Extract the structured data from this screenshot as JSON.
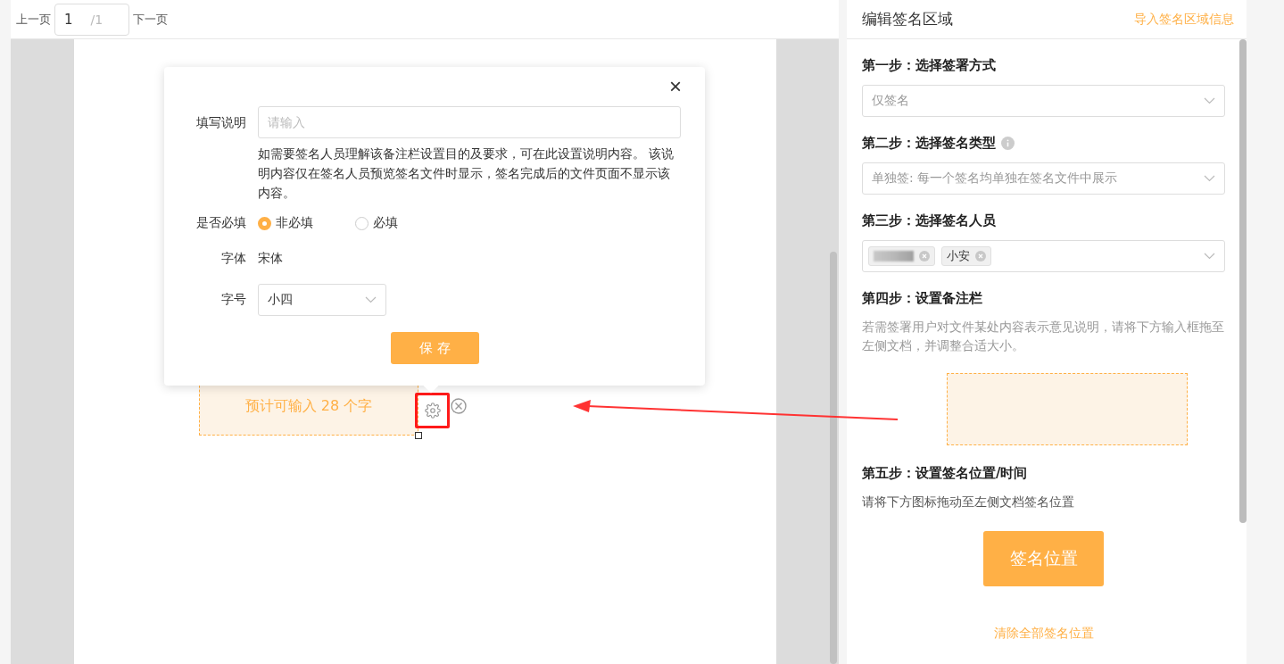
{
  "pager": {
    "prev": "上一页",
    "page": "1",
    "total": "/1",
    "next": "下一页"
  },
  "popover": {
    "close": "×",
    "fields": [
      {
        "kind": "input",
        "label": "填写说明",
        "placeholder": "请输入",
        "help": "如需要签名人员理解该备注栏设置目的及要求，可在此设置说明内容。 该说明内容仅在签名人员预览签名文件时显示，签名完成后的文件页面不显示该内容。"
      },
      {
        "kind": "radio",
        "label": "是否必填",
        "options": [
          {
            "label": "非必填",
            "selected": true
          },
          {
            "label": "必填",
            "selected": false
          }
        ]
      },
      {
        "kind": "text",
        "label": "字体",
        "value": "宋体"
      },
      {
        "kind": "select",
        "label": "字号",
        "value": "小四"
      }
    ],
    "save": "保 存"
  },
  "annotation": {
    "text": "预计可输入 28 个字",
    "highlighted": true
  },
  "panel": {
    "title": "编辑签名区域",
    "import_link": "导入签名区域信息",
    "steps": [
      {
        "kind": "select",
        "title": "第一步：选择签署方式",
        "value": "仅签名"
      },
      {
        "kind": "select",
        "title": "第二步：选择签名类型",
        "info": true,
        "value": "单独签: 每一个签名均单独在签名文件中展示"
      },
      {
        "kind": "tags",
        "title": "第三步：选择签名人员",
        "tags": [
          {
            "kind": "redacted"
          },
          {
            "kind": "text",
            "label": "小安"
          }
        ]
      },
      {
        "kind": "remark",
        "title": "第四步：设置备注栏",
        "description": "若需签署用户对文件某处内容表示意见说明，请将下方输入框拖至左侧文档，并调整合适大小。"
      },
      {
        "kind": "position",
        "title": "第五步：设置签名位置/时间",
        "description": "请将下方图标拖动至左侧文档签名位置",
        "button": "签名位置",
        "link": "清除全部签名位置"
      }
    ]
  }
}
